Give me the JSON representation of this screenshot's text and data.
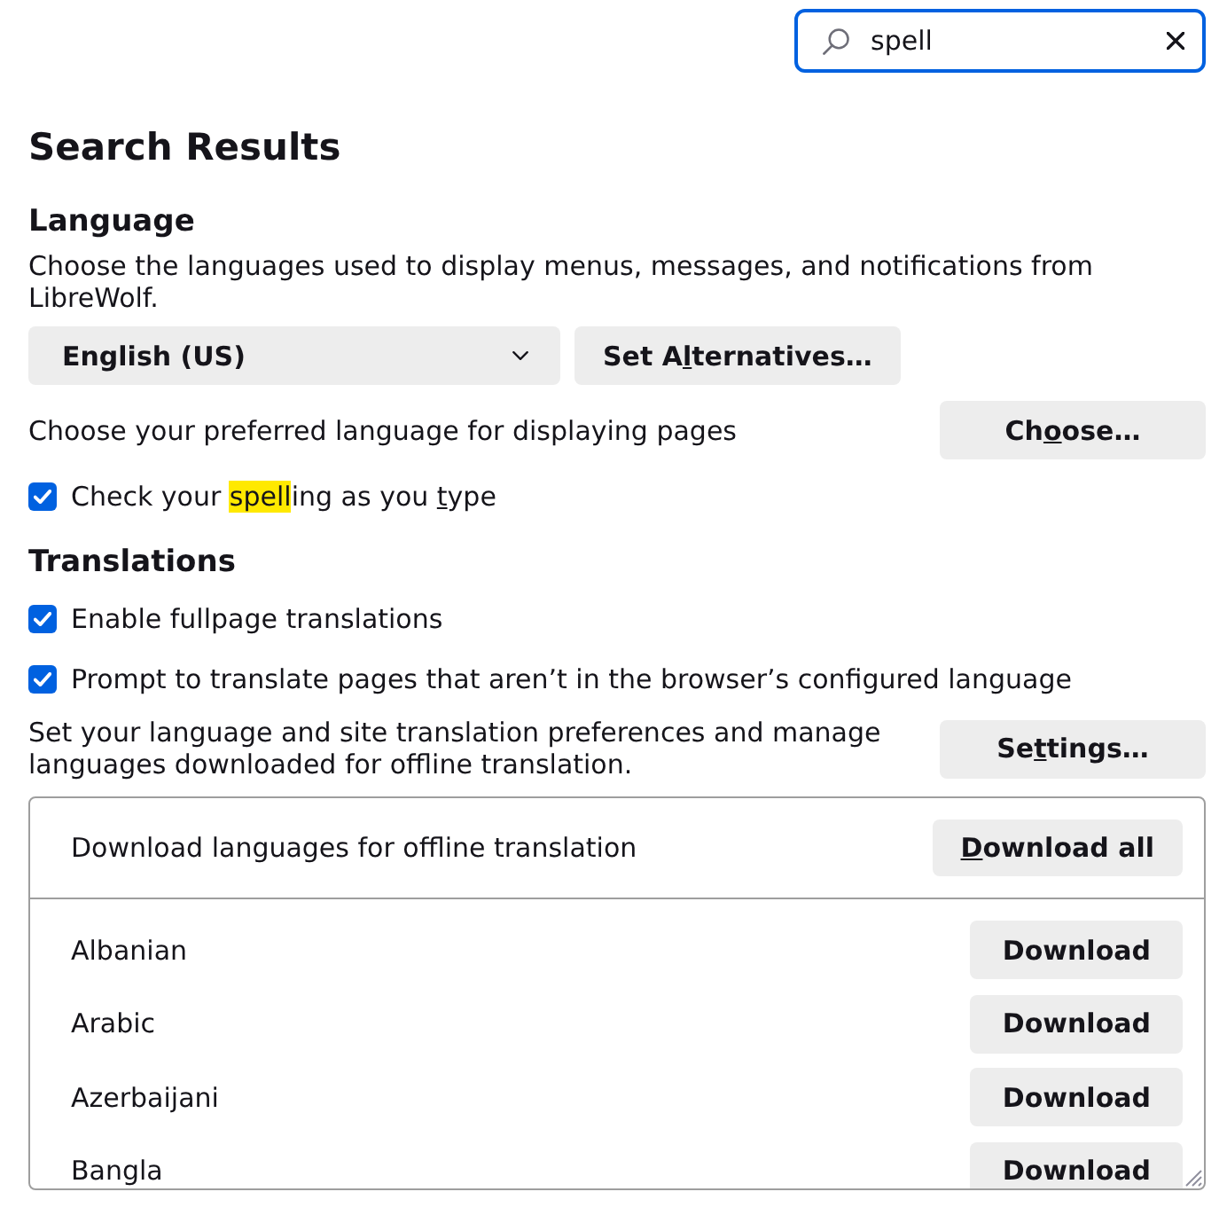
{
  "search": {
    "value": "spell"
  },
  "heading": "Search Results",
  "language": {
    "title": "Language",
    "description": "Choose the languages used to display menus, messages, and notifications from LibreWolf.",
    "dropdown": {
      "value": "English (US)"
    },
    "alternatives_button": {
      "label": [
        {
          "kind": "plain",
          "text": "Set A"
        },
        {
          "kind": "accesskey",
          "text": "l"
        },
        {
          "kind": "plain",
          "text": "ternatives…"
        }
      ]
    },
    "pages": {
      "text": "Choose your preferred language for displaying pages",
      "button": {
        "label": [
          {
            "kind": "plain",
            "text": "Ch"
          },
          {
            "kind": "accesskey",
            "text": "o"
          },
          {
            "kind": "plain",
            "text": "ose…"
          }
        ]
      }
    },
    "spellcheck": {
      "checked": true,
      "label": [
        {
          "kind": "plain",
          "text": "Check your "
        },
        {
          "kind": "highlight",
          "text": "spell"
        },
        {
          "kind": "plain",
          "text": "ing as you "
        },
        {
          "kind": "accesskey",
          "text": "t"
        },
        {
          "kind": "plain",
          "text": "ype"
        }
      ]
    }
  },
  "translations": {
    "title": "Translations",
    "options": [
      {
        "checked": true,
        "label": [
          {
            "kind": "plain",
            "text": "Enable fullpage translations"
          }
        ]
      },
      {
        "checked": true,
        "label": [
          {
            "kind": "plain",
            "text": "Prompt to translate pages that aren’t in the browser’s configured language"
          }
        ]
      }
    ],
    "settings": {
      "text": "Set your language and site translation preferences and manage languages downloaded for offline translation.",
      "button": {
        "label": [
          {
            "kind": "plain",
            "text": "Se"
          },
          {
            "kind": "accesskey",
            "text": "t"
          },
          {
            "kind": "plain",
            "text": "tings…"
          }
        ]
      }
    }
  },
  "downloads": {
    "title": "Download languages for offline translation",
    "button": {
      "label": [
        {
          "kind": "accesskey",
          "text": "D"
        },
        {
          "kind": "plain",
          "text": "ownload all"
        }
      ]
    },
    "languages": [
      {
        "name": "Albanian",
        "button": "Download"
      },
      {
        "name": "Arabic",
        "button": "Download"
      },
      {
        "name": "Azerbaijani",
        "button": "Download"
      },
      {
        "name": "Bangla",
        "button": "Download"
      }
    ]
  }
}
